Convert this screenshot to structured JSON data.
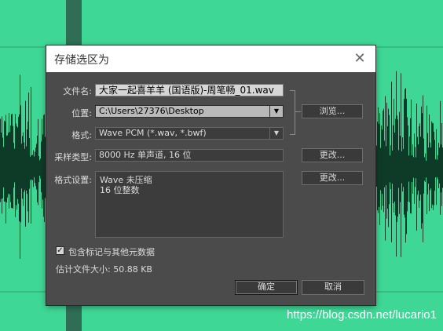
{
  "dialog": {
    "title": "存储选区为",
    "close_icon": "close-icon"
  },
  "fields": {
    "filename_label": "文件名:",
    "filename_value": "大家一起喜羊羊 (国语版)-周笔畅_01.wav",
    "location_label": "位置:",
    "location_value": "C:\\Users\\27376\\Desktop",
    "format_label": "格式:",
    "format_value": "Wave PCM (*.wav, *.bwf)",
    "sample_type_label": "采样类型:",
    "sample_type_value": "8000 Hz 单声道, 16 位",
    "format_settings_label": "格式设置:",
    "format_settings_lines": [
      "Wave 未压缩",
      "16 位整数"
    ]
  },
  "buttons": {
    "browse": "浏览...",
    "change_sample": "更改...",
    "change_format": "更改...",
    "ok": "确定",
    "cancel": "取消"
  },
  "options": {
    "include_markers_checked": true,
    "include_markers_label": "包含标记与其他元数据",
    "estimated_size": "估计文件大小: 50.88 KB"
  },
  "watermark": "https://blog.csdn.net/lucario1",
  "colors": {
    "background": "#3fd796",
    "dialog": "#4b4b4b",
    "titlebar": "#ffffff"
  }
}
